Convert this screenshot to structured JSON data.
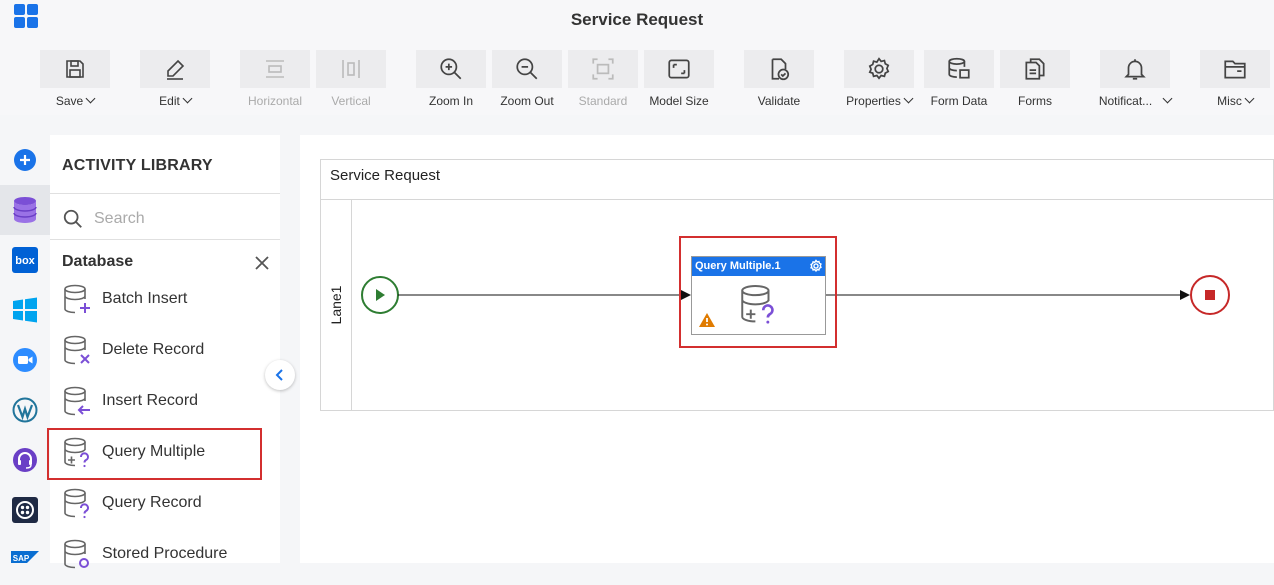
{
  "app": {
    "title": "Service Request"
  },
  "toolbar": {
    "save": "Save",
    "edit": "Edit",
    "horizontal": "Horizontal",
    "vertical": "Vertical",
    "zoom_in": "Zoom In",
    "zoom_out": "Zoom Out",
    "standard": "Standard",
    "model_size": "Model Size",
    "validate": "Validate",
    "properties": "Properties",
    "form_data": "Form Data",
    "forms": "Forms",
    "notifications": "Notificat...",
    "misc": "Misc"
  },
  "rail": {
    "items": [
      "add-icon",
      "database-icon",
      "box-icon",
      "windows-icon",
      "zoom-video-icon",
      "wordpress-icon",
      "headset-icon",
      "twilio-icon",
      "sap-icon"
    ],
    "box_text": "box",
    "sap_text": "SAP"
  },
  "library": {
    "heading": "ACTIVITY LIBRARY",
    "search_placeholder": "Search",
    "category": "Database",
    "items": [
      {
        "label": "Batch Insert"
      },
      {
        "label": "Delete Record"
      },
      {
        "label": "Insert Record"
      },
      {
        "label": "Query Multiple"
      },
      {
        "label": "Query Record"
      },
      {
        "label": "Stored Procedure"
      }
    ]
  },
  "canvas": {
    "pool_title": "Service Request",
    "lane": "Lane1",
    "task_title": "Query Multiple.1"
  },
  "colors": {
    "accent": "#1a73e8",
    "start": "#2e7d32",
    "end": "#c62828",
    "highlight": "#d32f2f",
    "icon_purple": "#7b4fd6",
    "warning": "#e07b00"
  }
}
